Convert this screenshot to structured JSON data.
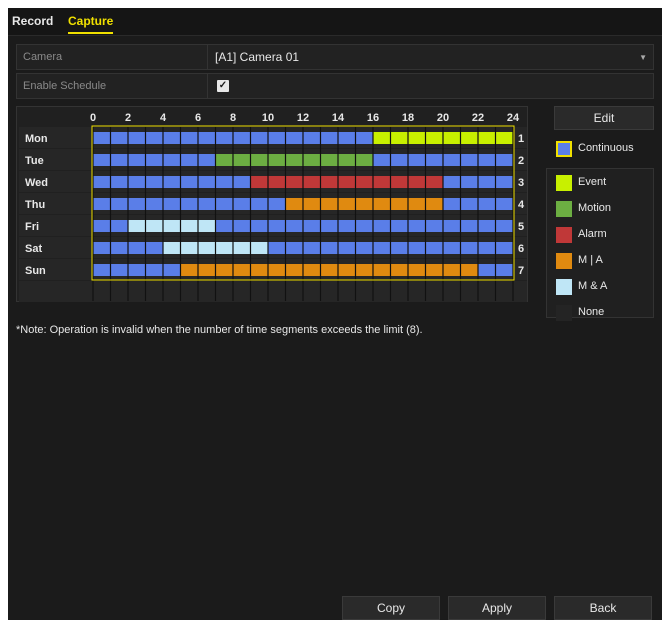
{
  "tabs": [
    {
      "label": "Record",
      "active": false
    },
    {
      "label": "Capture",
      "active": true
    }
  ],
  "camera": {
    "label": "Camera",
    "value": "[A1] Camera 01"
  },
  "enable_schedule": {
    "label": "Enable Schedule",
    "checked": true
  },
  "schedule": {
    "hour_labels": [
      "0",
      "2",
      "4",
      "6",
      "8",
      "10",
      "12",
      "14",
      "16",
      "18",
      "20",
      "22",
      "24"
    ],
    "days": [
      {
        "name": "Mon",
        "number": "1",
        "segments": [
          {
            "from": 0,
            "to": 16,
            "type": "continuous"
          },
          {
            "from": 16,
            "to": 24,
            "type": "event"
          }
        ]
      },
      {
        "name": "Tue",
        "number": "2",
        "segments": [
          {
            "from": 0,
            "to": 7,
            "type": "continuous"
          },
          {
            "from": 7,
            "to": 16,
            "type": "motion"
          },
          {
            "from": 16,
            "to": 24,
            "type": "continuous"
          }
        ]
      },
      {
        "name": "Wed",
        "number": "3",
        "segments": [
          {
            "from": 0,
            "to": 9,
            "type": "continuous"
          },
          {
            "from": 9,
            "to": 20,
            "type": "alarm"
          },
          {
            "from": 20,
            "to": 24,
            "type": "continuous"
          }
        ]
      },
      {
        "name": "Thu",
        "number": "4",
        "segments": [
          {
            "from": 0,
            "to": 11,
            "type": "continuous"
          },
          {
            "from": 11,
            "to": 20,
            "type": "m_or_a"
          },
          {
            "from": 20,
            "to": 24,
            "type": "continuous"
          }
        ]
      },
      {
        "name": "Fri",
        "number": "5",
        "segments": [
          {
            "from": 0,
            "to": 2,
            "type": "continuous"
          },
          {
            "from": 2,
            "to": 7,
            "type": "m_and_a"
          },
          {
            "from": 7,
            "to": 24,
            "type": "continuous"
          }
        ]
      },
      {
        "name": "Sat",
        "number": "6",
        "segments": [
          {
            "from": 0,
            "to": 4,
            "type": "continuous"
          },
          {
            "from": 4,
            "to": 10,
            "type": "m_and_a"
          },
          {
            "from": 10,
            "to": 24,
            "type": "continuous"
          }
        ]
      },
      {
        "name": "Sun",
        "number": "7",
        "segments": [
          {
            "from": 0,
            "to": 5,
            "type": "continuous"
          },
          {
            "from": 5,
            "to": 22,
            "type": "m_or_a"
          },
          {
            "from": 22,
            "to": 24,
            "type": "continuous"
          }
        ]
      }
    ]
  },
  "legend": {
    "edit_label": "Edit",
    "items": [
      {
        "key": "continuous",
        "label": "Continuous",
        "color": "#5a7ee8"
      },
      {
        "key": "event",
        "label": "Event",
        "color": "#c8f000"
      },
      {
        "key": "motion",
        "label": "Motion",
        "color": "#6cae42"
      },
      {
        "key": "alarm",
        "label": "Alarm",
        "color": "#c03838"
      },
      {
        "key": "m_or_a",
        "label": "M | A",
        "color": "#e08a10"
      },
      {
        "key": "m_and_a",
        "label": "M & A",
        "color": "#bfe6f6"
      },
      {
        "key": "none",
        "label": "None",
        "color": "#242424"
      }
    ]
  },
  "note": "*Note: Operation is invalid when the number of time segments exceeds the limit (8).",
  "footer": {
    "copy": "Copy",
    "apply": "Apply",
    "back": "Back"
  },
  "colors": {
    "accent": "#f0e000",
    "background": "#1b1b1b",
    "grid_line": "#111111"
  }
}
